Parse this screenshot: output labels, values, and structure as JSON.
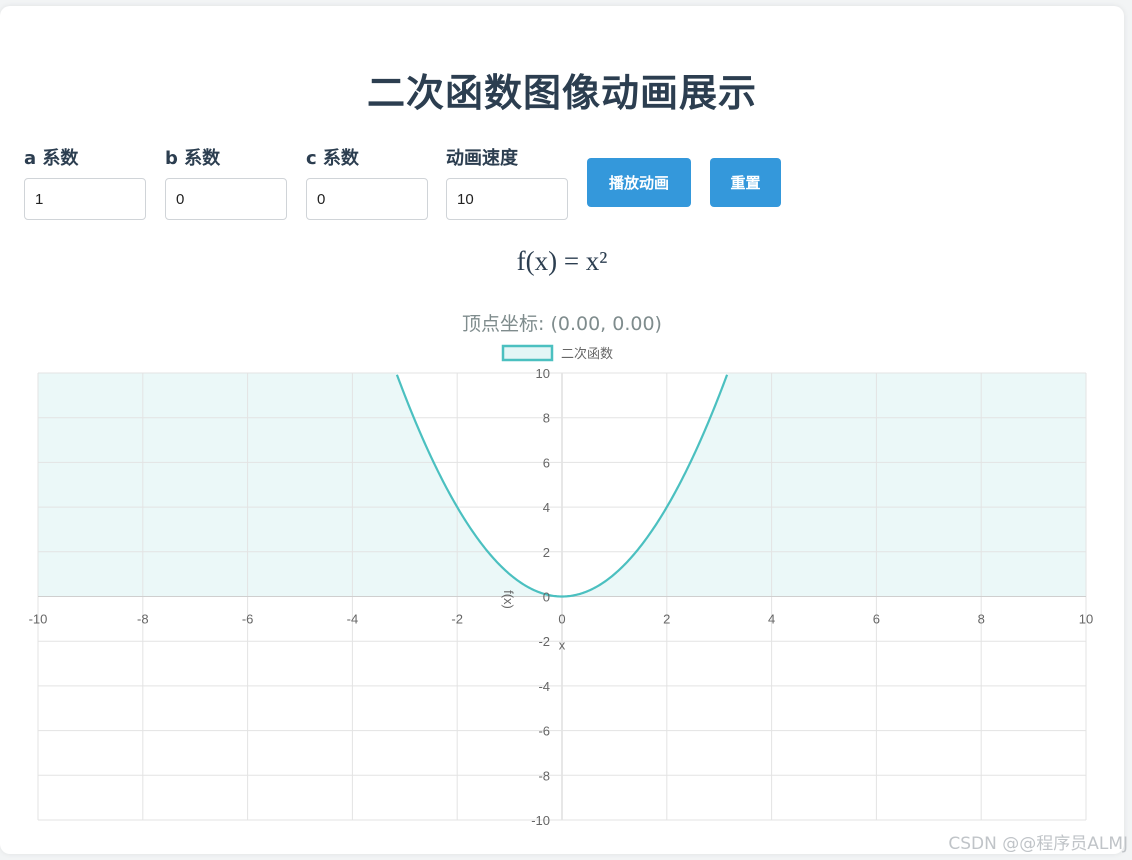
{
  "title": "二次函数图像动画展示",
  "controls": {
    "a": {
      "label": "a 系数",
      "value": "1"
    },
    "b": {
      "label": "b 系数",
      "value": "0"
    },
    "c": {
      "label": "c 系数",
      "value": "0"
    },
    "speed": {
      "label": "动画速度",
      "value": "10"
    }
  },
  "buttons": {
    "play": "播放动画",
    "reset": "重置"
  },
  "formula": "f(x) = x²",
  "vertex_text": "顶点坐标: (0.00, 0.00)",
  "watermark": "CSDN @@程序员ALMJ",
  "chart_data": {
    "type": "line",
    "series": [
      {
        "name": "二次函数",
        "function": "x^2",
        "a": 1,
        "b": 0,
        "c": 0,
        "color": "#4bc0c0",
        "fill": "origin",
        "fill_color": "#4bc0c0"
      }
    ],
    "xlabel": "x",
    "ylabel": "f(x)",
    "xlim": [
      -10,
      10
    ],
    "ylim": [
      -10,
      10
    ],
    "x_ticks": [
      -10,
      -8,
      -6,
      -4,
      -2,
      0,
      2,
      4,
      6,
      8,
      10
    ],
    "y_ticks": [
      -10,
      -8,
      -6,
      -4,
      -2,
      0,
      2,
      4,
      6,
      8,
      10
    ],
    "grid": true,
    "legend": "top"
  }
}
